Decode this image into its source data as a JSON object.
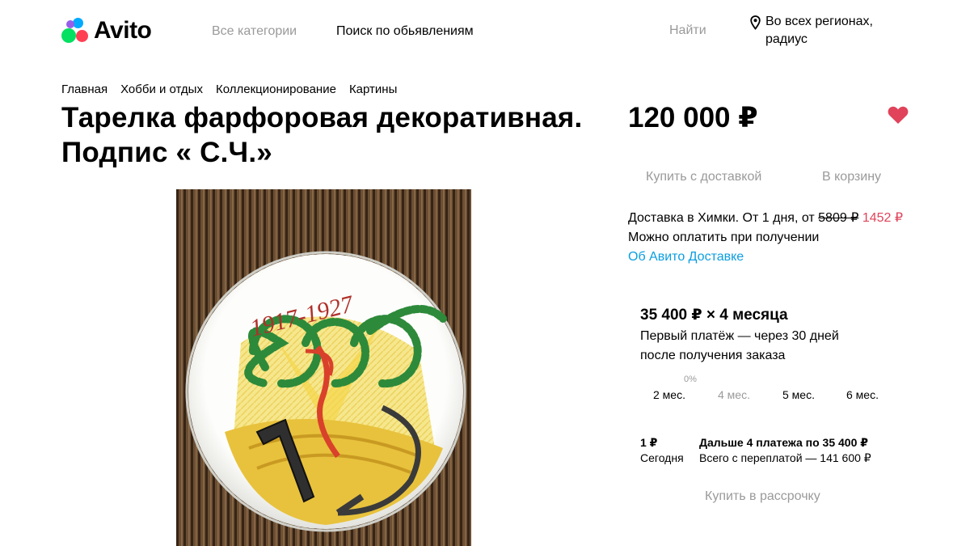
{
  "header": {
    "logo_text": "Avito",
    "nav_categories": "Все категории",
    "nav_search": "Поиск по обьявлениям",
    "find_button": "Найти",
    "region_line1": "Во всех регионах,",
    "region_line2": "радиус",
    "icons": [
      "map-pin-icon"
    ]
  },
  "breadcrumb": [
    "Главная",
    "Хобби и отдых",
    "Коллекционирование",
    "Картины"
  ],
  "listing": {
    "title_line1": "Тарелка фарфоровая декоративная.",
    "title_line2": "Подпис « С.Ч.»",
    "plate_text": "1917-1927"
  },
  "purchase": {
    "price": "120 000 ₽",
    "favorite_icon": "heart-icon",
    "favorite_color": "#e0435a",
    "buy_delivery": "Купить с доставкой",
    "add_to_cart": "В корзину",
    "delivery_text": "Доставка в Химки. От 1 дня, от",
    "old_price": "5809 ₽",
    "new_price": "1452 ₽",
    "pay_on_receipt": "Можно оплатить при получении",
    "about_delivery": "Об Авито Доставке"
  },
  "installment": {
    "title": "35 400 ₽ × 4 месяца",
    "subtitle_line1": "Первый платёж — через 30 дней",
    "subtitle_line2": "после получения заказа",
    "zero_percent": "0%",
    "options": [
      "2 мес.",
      "4 мес.",
      "5 мес.",
      "6 мес."
    ],
    "selected_option": "4 мес.",
    "first_amount": "1 ₽",
    "first_label": "Сегодня",
    "next_label": "Дальше 4 платежа по 35 400 ₽",
    "total_label": "Всего с переплатой — 141 600 ₽",
    "buy_button": "Купить в рассрочку"
  }
}
